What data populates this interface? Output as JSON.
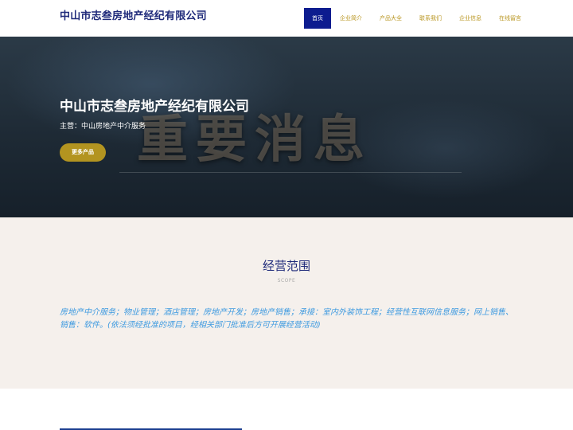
{
  "header": {
    "brand": "中山市志叁房地产经纪有限公司",
    "nav": [
      "首页",
      "企业简介",
      "产品大全",
      "联系我们",
      "企业信息",
      "在线留言"
    ]
  },
  "hero": {
    "watermark": "重要消息",
    "title": "中山市志叁房地产经纪有限公司",
    "subtitle": "主营：中山房地产中介服务",
    "button": "更多产品"
  },
  "scope": {
    "title": "经营范围",
    "subtitle": "SCOPE",
    "text": "房地产中介服务；物业管理；酒店管理；房地产开发；房地产销售；承接：室内外装饰工程；经营性互联网信息服务；网上销售、销售：软件。(依法须经批准的项目，经相关部门批准后方可开展经营活动)"
  },
  "colors": {
    "accent": "#0d1c8f",
    "gold": "#b39420",
    "scope_text": "#3e9ae0"
  }
}
